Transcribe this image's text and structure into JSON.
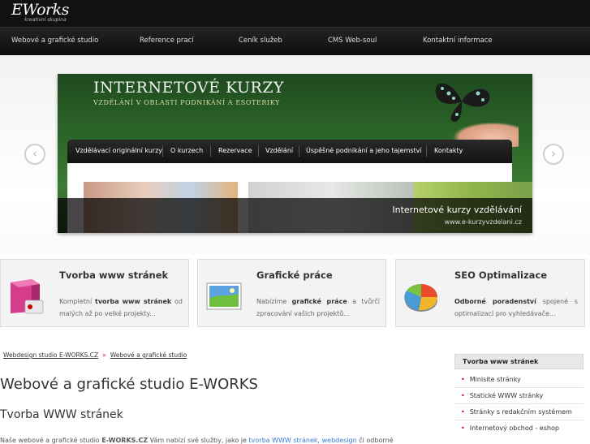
{
  "header": {
    "logo_text": "Works",
    "logo_prefix": "E",
    "logo_tagline": "kreativní skupina"
  },
  "nav": {
    "items": [
      {
        "label": "Webové a grafické studio"
      },
      {
        "label": "Reference prací"
      },
      {
        "label": "Ceník služeb"
      },
      {
        "label": "CMS Web-soul"
      },
      {
        "label": "Kontaktní informace"
      }
    ]
  },
  "slider": {
    "title": "INTERNETOVÉ KURZY",
    "subtitle": "VZDĚLÁNÍ V OBLASTI PODNIKÁNÍ A ESOTERIKY",
    "menu": [
      {
        "label": "Vzdělávací originální kurzy"
      },
      {
        "label": "O kurzech"
      },
      {
        "label": "Rezervace"
      },
      {
        "label": "Vzdělání"
      },
      {
        "label": "Úspěšné podnikání a jeho tajemství"
      },
      {
        "label": "Kontakty"
      }
    ],
    "caption_title": "Internetové kurzy vzdělávání",
    "caption_url": "www.e-kurzyvzdelani.cz",
    "prev_label": "‹",
    "next_label": "›"
  },
  "services": [
    {
      "title": "Tvorba www stránek",
      "text_pre": "Kompletní ",
      "text_bold": "tvorba www stránek",
      "text_post": " od malých až po velké projekty...",
      "icon": "software-box-icon"
    },
    {
      "title": "Grafické práce",
      "text_pre": "Nabízíme ",
      "text_bold": "grafické práce",
      "text_post": " a tvůrčí zpracování vašich projektů...",
      "icon": "picture-icon"
    },
    {
      "title": "SEO Optimalizace",
      "text_pre": "",
      "text_bold": "Odborné poradenství",
      "text_post": " spojené s optimalizací pro vyhledávače...",
      "icon": "pie-chart-icon"
    }
  ],
  "breadcrumb": {
    "items": [
      "Webdesign studio E-WORKS.CZ",
      "Webové a grafické studio"
    ],
    "separator": "»"
  },
  "content": {
    "heading": "Webové a grafické studio E-WORKS",
    "subheading": "Tvorba WWW stránek",
    "para_start": "Naše webové a grafické studio ",
    "para_bold": "E-WORKS.CZ",
    "para_mid": " Vám nabízí své služby, jako je ",
    "para_link1": "tvorba WWW stránek",
    "para_comma": ", ",
    "para_link2": "webdesign",
    "para_end": " či odborné"
  },
  "sidebar": {
    "heading": "Tvorba www stránek",
    "items": [
      {
        "label": "Minisite stránky"
      },
      {
        "label": "Statické WWW stránky"
      },
      {
        "label": "Stránky s redakčním systémem"
      },
      {
        "label": "Internetový obchod - eshop"
      }
    ]
  }
}
